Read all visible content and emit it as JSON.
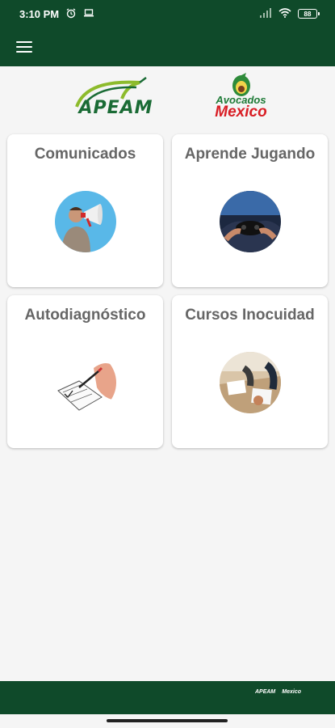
{
  "status_bar": {
    "time": "3:10 PM",
    "battery": "88",
    "icons": [
      "alarm-icon",
      "laptop-icon",
      "signal-icon",
      "wifi-icon",
      "battery-icon"
    ]
  },
  "app_bar": {
    "menu_icon": "hamburger-menu-icon"
  },
  "logos": {
    "apeam": "APEAM",
    "avocados": "Avocados",
    "mexico": "Mexico"
  },
  "cards": [
    {
      "title": "Comunicados",
      "image": "man-with-megaphone"
    },
    {
      "title": "Aprende Jugando",
      "image": "hands-with-game-controller"
    },
    {
      "title": "Autodiagnóstico",
      "image": "hand-writing-on-checklist"
    },
    {
      "title": "Cursos Inocuidad",
      "image": "people-taking-notes-in-class"
    }
  ],
  "footer": {
    "apeam": "APEAM",
    "mexico": "Mexico"
  },
  "colors": {
    "primary": "#0f4a2a",
    "card_title": "#666666",
    "background": "#f5f5f5"
  }
}
